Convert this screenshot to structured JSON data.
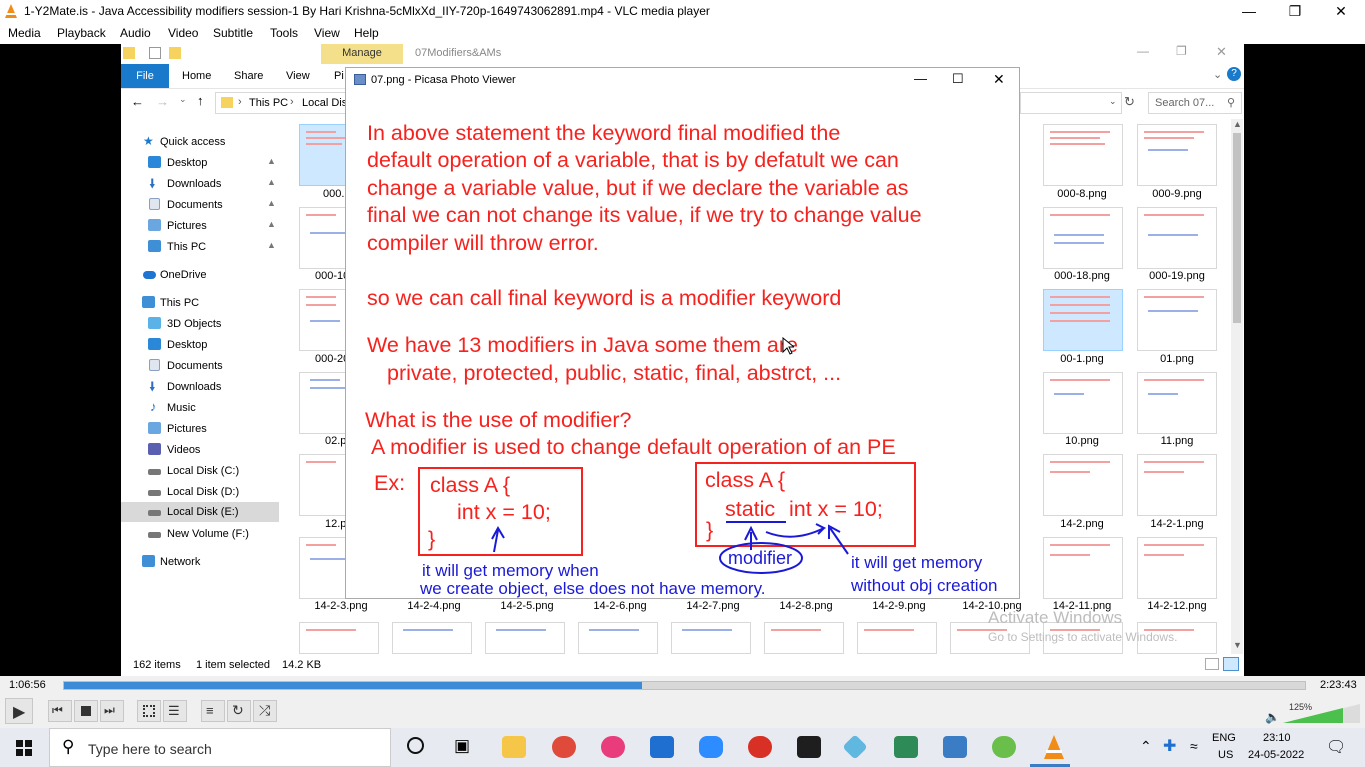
{
  "vlc": {
    "title": "1-Y2Mate.is - Java Accessibility modifiers session-1  By Hari Krishna-5cMlxXd_IIY-720p-1649743062891.mp4 - VLC media player",
    "menu": [
      "Media",
      "Playback",
      "Audio",
      "Video",
      "Subtitle",
      "Tools",
      "View",
      "Help"
    ],
    "time_elapsed": "1:06:56",
    "time_total": "2:23:43",
    "progress_fraction": 0.466,
    "volume": "125%"
  },
  "explorer": {
    "ribbon_manage": "Manage",
    "title_folder": "07Modifiers&AMs",
    "ribbon_tabs": [
      "File",
      "Home",
      "Share",
      "View",
      "Pi"
    ],
    "address": [
      "This PC",
      "Local Dis"
    ],
    "search_placeholder": "Search 07...",
    "nav": {
      "quick_access": "Quick access",
      "qa_items": [
        "Desktop",
        "Downloads",
        "Documents",
        "Pictures",
        "This PC"
      ],
      "onedrive": "OneDrive",
      "this_pc": "This PC",
      "pc_items": [
        "3D Objects",
        "Desktop",
        "Documents",
        "Downloads",
        "Music",
        "Pictures",
        "Videos",
        "Local Disk (C:)",
        "Local Disk (D:)",
        "Local Disk (E:)",
        "New Volume (F:)"
      ],
      "network": "Network"
    },
    "left_labels": [
      "000.p",
      "000-10",
      "000-20",
      "02.p",
      "12.p"
    ],
    "right_labels": [
      "000-8.png",
      "000-9.png",
      "000-18.png",
      "000-19.png",
      "00-1.png",
      "01.png",
      "10.png",
      "11.png",
      "14-2.png",
      "14-2-1.png",
      "14-2-11.png",
      "14-2-12.png"
    ],
    "bottom_labels": [
      "14-2-3.png",
      "14-2-4.png",
      "14-2-5.png",
      "14-2-6.png",
      "14-2-7.png",
      "14-2-8.png",
      "14-2-9.png",
      "14-2-10.png"
    ],
    "status_items": "162 items",
    "status_selected": "1 item selected",
    "status_size": "14.2 KB",
    "watermark_1": "Activate Windows",
    "watermark_2": "Go to Settings to activate Windows."
  },
  "picasa": {
    "title": "07.png - Picasa Photo Viewer",
    "slide": {
      "p1": [
        "In above statement the keyword final modified the",
        "default operation of a variable, that is by defatult we can",
        "change a variable value, but if we declare the variable as",
        "final we can not change its value, if we try to change value",
        "compiler will throw error."
      ],
      "p2": "so we can call final keyword is a modifier keyword",
      "p3a": "We have 13 modifiers in Java some them are",
      "p3b": "private, protected, public, static, final, abstrct, ...",
      "q": "What is the use of modifier?",
      "a": "A modifier is used to change default operation of an PE",
      "ex": "Ex:",
      "box1": [
        "class A {",
        "int x = 10;",
        "}"
      ],
      "box2_line1": "class A {",
      "box2_static": "static",
      "box2_rest": "int x = 10;",
      "box2_close": "}",
      "note1": [
        "it will get memory when",
        "we create object, else does not have memory."
      ],
      "modifier": "modifier",
      "note2": [
        "it will get memory",
        "without obj creation"
      ]
    }
  },
  "taskbar": {
    "search_placeholder": "Type here to search",
    "lang_1": "ENG",
    "lang_2": "US",
    "time": "23:10",
    "date": "24-05-2022"
  }
}
